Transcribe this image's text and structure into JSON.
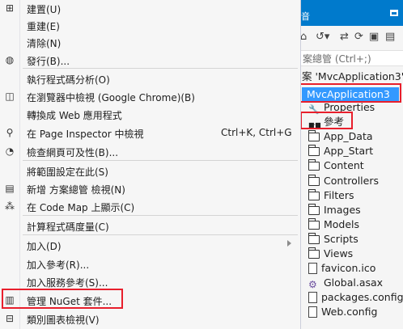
{
  "menu": {
    "items": [
      {
        "label": "建置(U)",
        "icon": "build-icon",
        "shortcut": "",
        "arrow": false
      },
      {
        "label": "重建(E)",
        "icon": "",
        "shortcut": "",
        "arrow": false
      },
      {
        "label": "清除(N)",
        "icon": "",
        "shortcut": "",
        "arrow": false
      },
      {
        "label": "發行(B)...",
        "icon": "globe-icon",
        "shortcut": "",
        "arrow": false
      },
      {
        "label": "執行程式碼分析(O)",
        "icon": "",
        "shortcut": "",
        "arrow": false
      },
      {
        "label": "在瀏覽器中檢視 (Google Chrome)(B)",
        "icon": "browser-icon",
        "shortcut": "",
        "arrow": false
      },
      {
        "label": "轉換成 Web 應用程式",
        "icon": "",
        "shortcut": "",
        "arrow": false
      },
      {
        "label": "在 Page Inspector 中檢視",
        "icon": "inspector-icon",
        "shortcut": "Ctrl+K, Ctrl+G",
        "arrow": false
      },
      {
        "label": "檢查網頁可及性(B)...",
        "icon": "accessibility-icon",
        "shortcut": "",
        "arrow": false
      },
      {
        "label": "將範圍設定在此(S)",
        "icon": "",
        "shortcut": "",
        "arrow": false
      },
      {
        "label": "新增 方案總管 檢視(N)",
        "icon": "new-view-icon",
        "shortcut": "",
        "arrow": false
      },
      {
        "label": "在 Code Map 上顯示(C)",
        "icon": "code-map-icon",
        "shortcut": "",
        "arrow": false
      },
      {
        "label": "計算程式碼度量(C)",
        "icon": "",
        "shortcut": "",
        "arrow": false
      },
      {
        "label": "加入(D)",
        "icon": "",
        "shortcut": "",
        "arrow": true
      },
      {
        "label": "加入參考(R)...",
        "icon": "",
        "shortcut": "",
        "arrow": false
      },
      {
        "label": "加入服務參考(S)...",
        "icon": "",
        "shortcut": "",
        "arrow": false
      },
      {
        "label": "管理 NuGet 套件...",
        "icon": "nuget-icon",
        "shortcut": "",
        "arrow": false
      },
      {
        "label": "類別圖表檢視(V)",
        "icon": "class-diagram-icon",
        "shortcut": "",
        "arrow": false
      }
    ]
  },
  "solution_explorer": {
    "title": "音",
    "search_placeholder": "案總管 (Ctrl+;)",
    "solution_line": "案 'MvcApplication3' (",
    "project": "MvcApplication3",
    "items": [
      {
        "label": "Properties",
        "icon": "wrench-icon"
      },
      {
        "label": "參考",
        "icon": "references-icon"
      },
      {
        "label": "App_Data",
        "icon": "folder-icon"
      },
      {
        "label": "App_Start",
        "icon": "folder-icon"
      },
      {
        "label": "Content",
        "icon": "folder-icon"
      },
      {
        "label": "Controllers",
        "icon": "folder-icon"
      },
      {
        "label": "Filters",
        "icon": "folder-icon"
      },
      {
        "label": "Images",
        "icon": "folder-icon"
      },
      {
        "label": "Models",
        "icon": "folder-icon"
      },
      {
        "label": "Scripts",
        "icon": "folder-icon"
      },
      {
        "label": "Views",
        "icon": "folder-icon"
      },
      {
        "label": "favicon.ico",
        "icon": "file-icon"
      },
      {
        "label": "Global.asax",
        "icon": "gear-file-icon"
      },
      {
        "label": "packages.config",
        "icon": "file-icon"
      },
      {
        "label": "Web.config",
        "icon": "file-icon"
      }
    ]
  },
  "colors": {
    "title_bar": "#007acc",
    "selection": "#3399ff",
    "highlight_border": "#e81f2c",
    "menu_bg": "#f6f6f6"
  }
}
